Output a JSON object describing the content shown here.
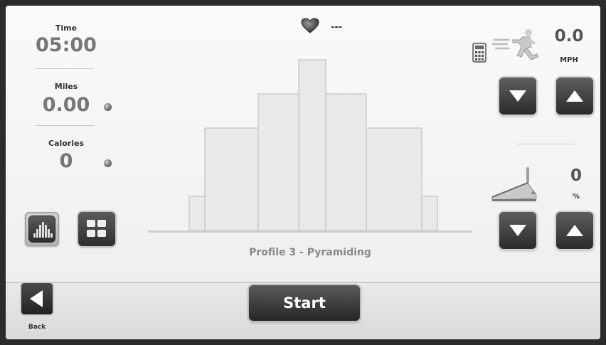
{
  "stats": {
    "time": {
      "label": "Time",
      "value": "05:00"
    },
    "miles": {
      "label": "Miles",
      "value": "0.00"
    },
    "calories": {
      "label": "Calories",
      "value": "0"
    }
  },
  "heart_rate": {
    "value": "---",
    "icon": "heart-icon"
  },
  "speed": {
    "value": "0.0",
    "unit": "MPH"
  },
  "incline": {
    "value": "0",
    "unit": "%"
  },
  "profile": {
    "name": "Profile 3 - Pyramiding",
    "levels": [
      1,
      3,
      4,
      5,
      4,
      3,
      1
    ],
    "level_max": 5
  },
  "modes": {
    "profile_view": "profile-chart-icon",
    "grid_view": "grid-view-icon",
    "active": "profile_view"
  },
  "footer": {
    "back_label": "Back",
    "start_label": "Start"
  },
  "colors": {
    "bar_fill": "#e9e9e9",
    "bar_stroke": "#b9b9b9",
    "button_dark": "#333333",
    "value_gray": "#777777"
  }
}
